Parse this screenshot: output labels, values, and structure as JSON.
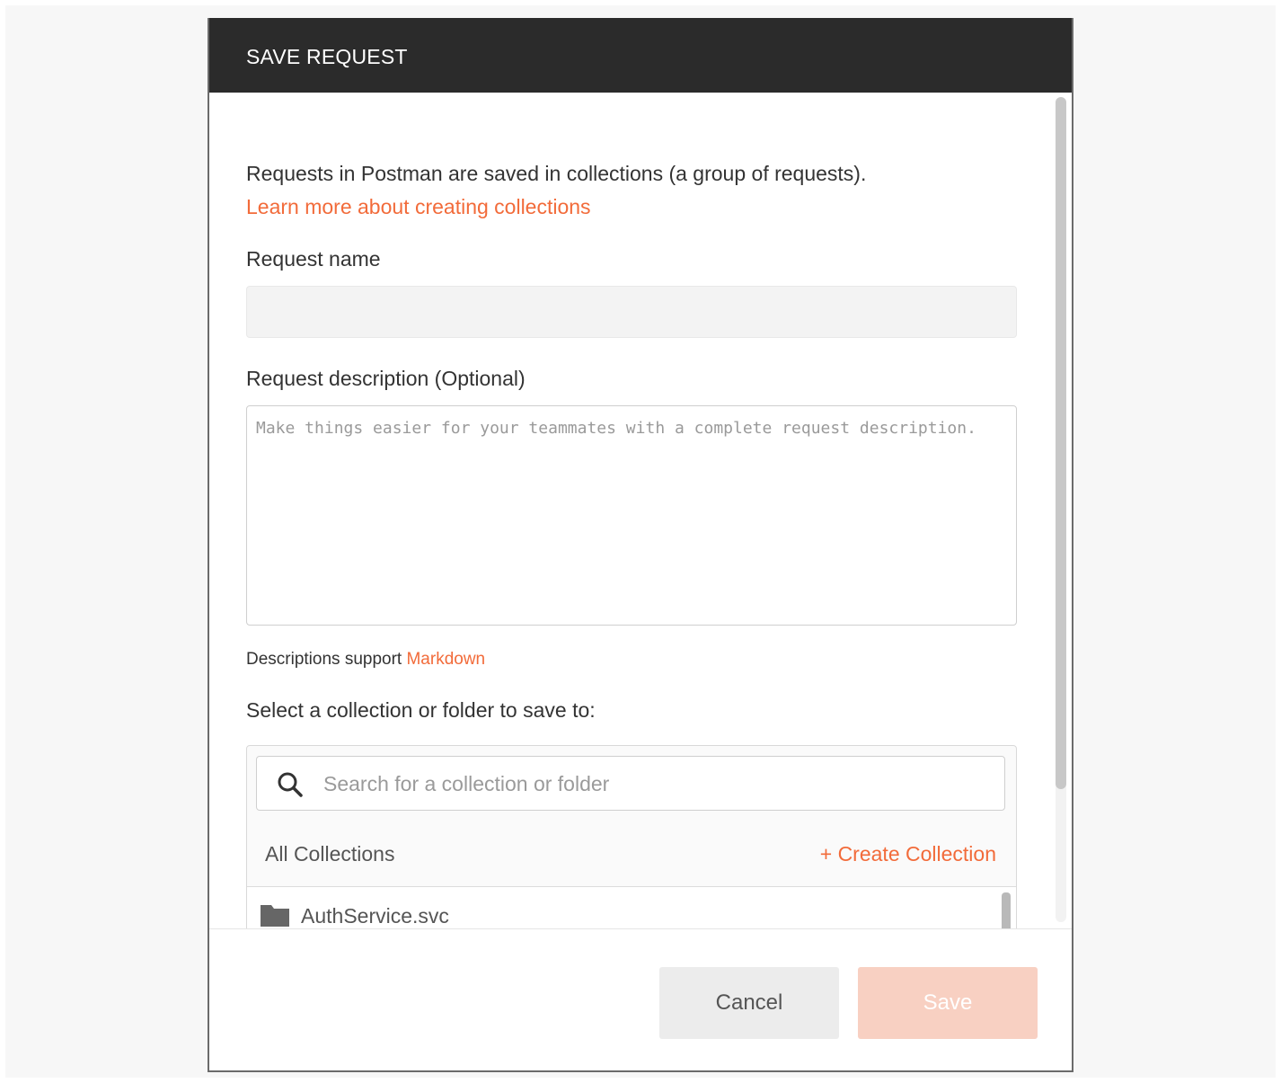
{
  "dialog": {
    "title": "SAVE REQUEST",
    "intro_text": "Requests in Postman are saved in collections (a group of requests).",
    "learn_more_link": "Learn more about creating collections"
  },
  "form": {
    "request_name_label": "Request name",
    "request_name_value": "",
    "description_label": "Request description (Optional)",
    "description_placeholder": "Make things easier for your teammates with a complete request description.",
    "markdown_note": "Descriptions support",
    "markdown_link": "Markdown",
    "select_label": "Select a collection or folder to save to:"
  },
  "collections": {
    "search_placeholder": "Search for a collection or folder",
    "all_collections_label": "All Collections",
    "create_collection_label": "+ Create Collection",
    "items": [
      {
        "name": "AuthService.svc",
        "icon": "folder-icon"
      }
    ]
  },
  "footer": {
    "cancel_label": "Cancel",
    "save_label": "Save"
  },
  "colors": {
    "accent": "#f26b3a",
    "header_bg": "#2b2b2b",
    "save_disabled_bg": "#f8d0c2"
  }
}
